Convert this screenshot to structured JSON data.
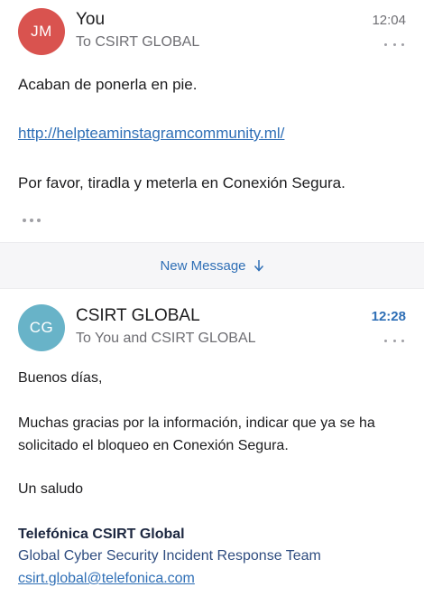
{
  "message1": {
    "avatar_initials": "JM",
    "avatar_color": "#d9534f",
    "sender": "You",
    "recipients": "To CSIRT GLOBAL",
    "time": "12:04",
    "body": {
      "line1": "Acaban de ponerla en pie.",
      "link": "http://helpteaminstagramcommunity.ml/",
      "line3": "Por favor, tiradla y meterla en Conexión Segura."
    }
  },
  "divider": {
    "new_message_label": "New Message"
  },
  "message2": {
    "avatar_initials": "CG",
    "avatar_color": "#68b3c8",
    "sender": "CSIRT GLOBAL",
    "recipients": "To You and CSIRT GLOBAL",
    "time": "12:28",
    "time_color": "#2f6fb6",
    "body": {
      "greeting": "Buenos días,",
      "para_line1": "Muchas gracias por la información, indicar que ya se ha",
      "para_line2": "solicitado el bloqueo en Conexión Segura.",
      "closing": "Un saludo",
      "sig_name": "Telefónica CSIRT Global",
      "sig_team": "Global Cyber Security Incident Response Team",
      "sig_email": "csirt.global@telefonica.com"
    }
  }
}
